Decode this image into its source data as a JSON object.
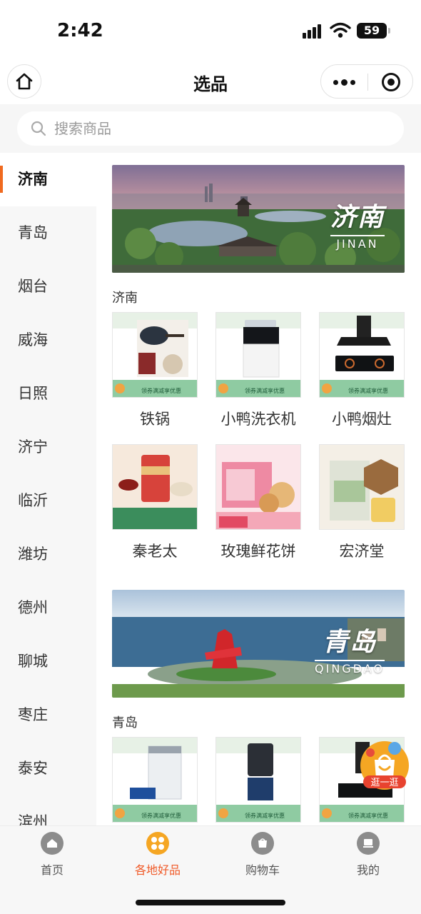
{
  "status_bar": {
    "time": "2:42",
    "battery": "59"
  },
  "nav": {
    "title": "选品"
  },
  "search": {
    "placeholder": "搜索商品"
  },
  "sidebar": {
    "items": [
      {
        "label": "济南",
        "active": true
      },
      {
        "label": "青岛"
      },
      {
        "label": "烟台"
      },
      {
        "label": "威海"
      },
      {
        "label": "日照"
      },
      {
        "label": "济宁"
      },
      {
        "label": "临沂"
      },
      {
        "label": "潍坊"
      },
      {
        "label": "德州"
      },
      {
        "label": "聊城"
      },
      {
        "label": "枣庄"
      },
      {
        "label": "泰安"
      },
      {
        "label": "滨州"
      }
    ]
  },
  "sections": [
    {
      "banner_cn": "济南",
      "banner_en": "JINAN",
      "title": "济南",
      "products": [
        {
          "name": "铁锅",
          "promo": "领券满减享优惠"
        },
        {
          "name": "小鸭洗衣机",
          "promo": "领券满减享优惠"
        },
        {
          "name": "小鸭烟灶",
          "promo": "领券满减享优惠"
        },
        {
          "name": "秦老太",
          "promo": ""
        },
        {
          "name": "玫瑰鲜花饼",
          "promo": ""
        },
        {
          "name": "宏济堂",
          "promo": ""
        }
      ]
    },
    {
      "banner_cn": "青岛",
      "banner_en": "QINGDAO",
      "title": "青岛",
      "products": [
        {
          "name": "",
          "promo": "领券满减享优惠"
        },
        {
          "name": "",
          "promo": "领券满减享优惠"
        },
        {
          "name": "",
          "promo": "领券满减享优惠"
        }
      ]
    }
  ],
  "float_badge": {
    "label": "逛一逛"
  },
  "tabbar": {
    "items": [
      {
        "label": "首页",
        "icon": "home-icon"
      },
      {
        "label": "各地好品",
        "icon": "local-goods-icon",
        "active": true
      },
      {
        "label": "购物车",
        "icon": "cart-icon"
      },
      {
        "label": "我的",
        "icon": "profile-icon"
      }
    ]
  },
  "colors": {
    "accent": "#f05a28",
    "sidebar_indicator": "#f06a1f",
    "promo_green": "#6fb98f"
  }
}
